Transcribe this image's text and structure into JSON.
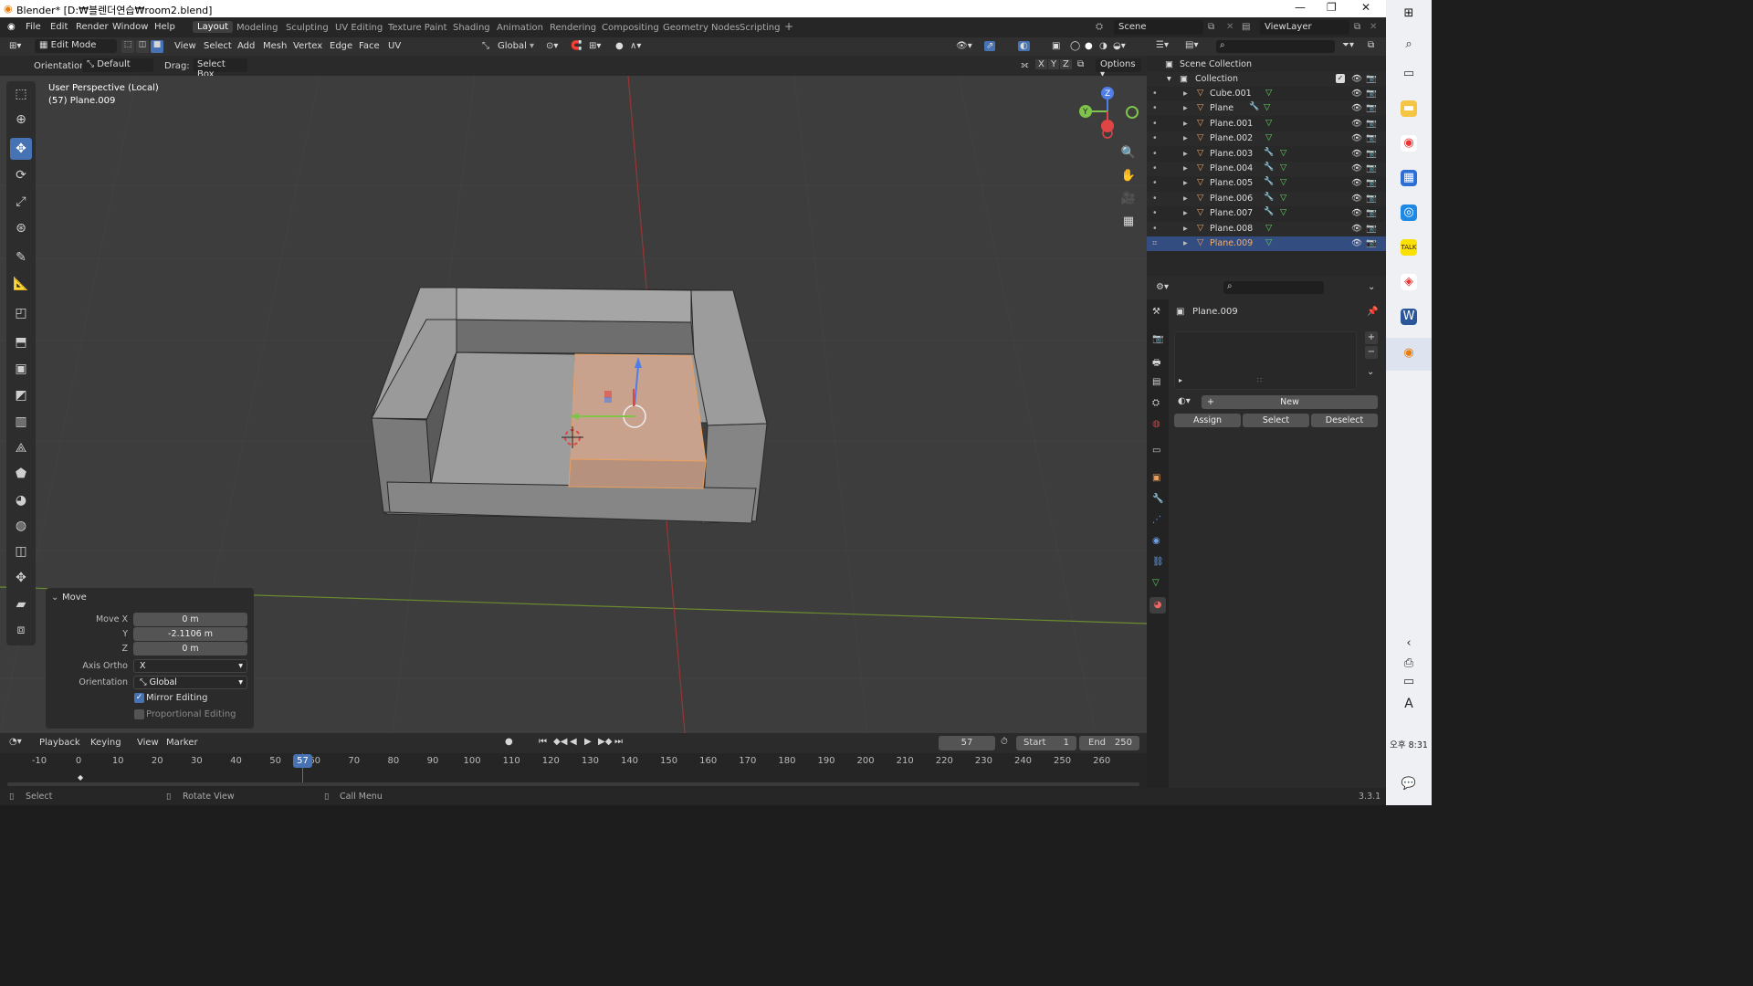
{
  "window": {
    "title": "Blender* [D:₩블렌더연습₩room2.blend]"
  },
  "menu": {
    "items": [
      "File",
      "Edit",
      "Render",
      "Window",
      "Help"
    ]
  },
  "workspaces": [
    "Layout",
    "Modeling",
    "Sculpting",
    "UV Editing",
    "Texture Paint",
    "Shading",
    "Animation",
    "Rendering",
    "Compositing",
    "Geometry Nodes",
    "Scripting"
  ],
  "top_right": {
    "scene": "Scene",
    "view_layer": "ViewLayer"
  },
  "viewport_header": {
    "mode": "Edit Mode",
    "menus": [
      "View",
      "Select",
      "Add",
      "Mesh",
      "Vertex",
      "Edge",
      "Face",
      "UV"
    ],
    "transform_orientation": "Global"
  },
  "tool_settings": {
    "orientation_label": "Orientation:",
    "orientation_value": "Default",
    "drag_label": "Drag:",
    "drag_value": "Select Box",
    "axes": [
      "X",
      "Y",
      "Z"
    ],
    "options_label": "Options"
  },
  "viewport_info": {
    "line1": "User Perspective (Local)",
    "line2": "(57) Plane.009"
  },
  "gizmo": {
    "x": "",
    "y": "Y",
    "z": "Z"
  },
  "move_panel": {
    "title": "Move",
    "labels": {
      "x": "Move X",
      "y": "Y",
      "z": "Z",
      "axis_ortho": "Axis Ortho",
      "orientation": "Orientation"
    },
    "values": {
      "x": "0 m",
      "y": "-2.1106 m",
      "z": "0 m",
      "axis_ortho": "X",
      "orientation": "Global"
    },
    "mirror_editing": {
      "label": "Mirror Editing",
      "checked": true
    },
    "proportional_editing": {
      "label": "Proportional Editing",
      "checked": false
    }
  },
  "timeline": {
    "menus": [
      "Playback",
      "Keying",
      "View",
      "Marker"
    ],
    "current_frame": "57",
    "start_label": "Start",
    "start": "1",
    "end_label": "End",
    "end": "250",
    "ticks": [
      "-10",
      "0",
      "10",
      "20",
      "30",
      "40",
      "50",
      "60",
      "70",
      "80",
      "90",
      "100",
      "110",
      "120",
      "130",
      "140",
      "150",
      "160",
      "170",
      "180",
      "190",
      "200",
      "210",
      "220",
      "230",
      "240",
      "250",
      "260"
    ],
    "playhead": "57"
  },
  "status": {
    "select": "Select",
    "rotate": "Rotate View",
    "menu": "Call Menu",
    "version": "3.3.1"
  },
  "outliner": {
    "scene_collection": "Scene Collection",
    "collection": "Collection",
    "objects": [
      "Cube.001",
      "Plane",
      "Plane.001",
      "Plane.002",
      "Plane.003",
      "Plane.004",
      "Plane.005",
      "Plane.006",
      "Plane.007",
      "Plane.008",
      "Plane.009"
    ],
    "selected": "Plane.009"
  },
  "properties": {
    "object_name": "Plane.009",
    "new_label": "New",
    "assign": "Assign",
    "select": "Select",
    "deselect": "Deselect"
  },
  "taskbar": {
    "time": "오후 8:31",
    "ime": "A",
    "notif": "1"
  },
  "colors": {
    "accent": "#4772b3",
    "selection_orange": "#e8a060",
    "viewport_bg": "#3d3d3d"
  }
}
